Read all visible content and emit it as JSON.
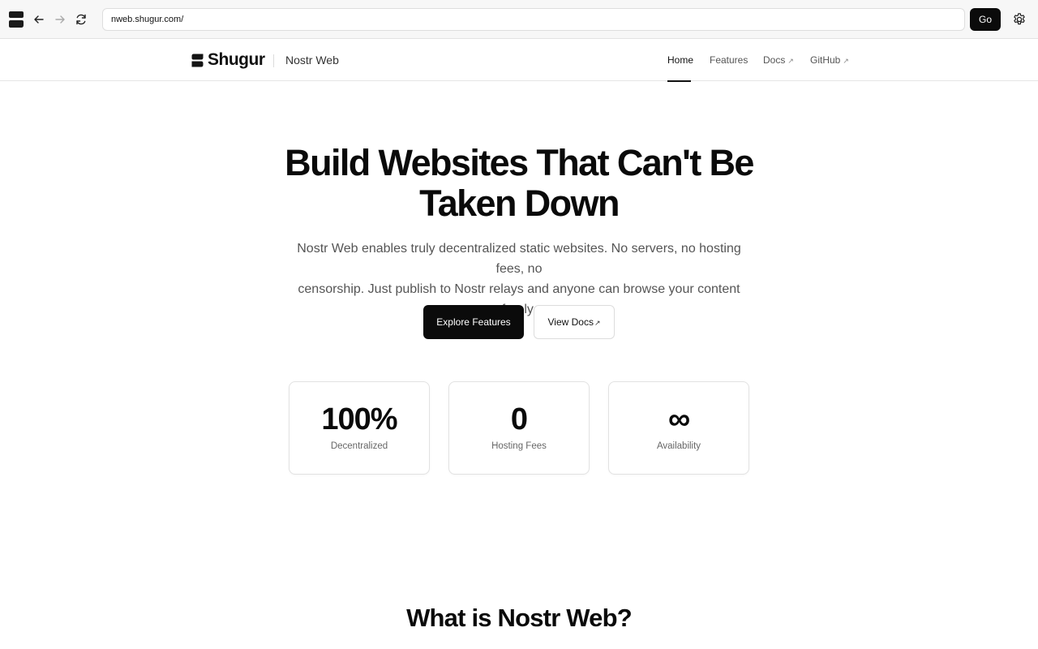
{
  "browser": {
    "url": "nweb.shugur.com/",
    "go_label": "Go",
    "icons": [
      "app-logo-icon",
      "back-arrow-icon",
      "forward-arrow-icon",
      "reload-icon",
      "gear-icon"
    ]
  },
  "header": {
    "brand_name": "Shugur",
    "product_name": "Nostr Web",
    "nav": [
      {
        "label": "Home",
        "active": true
      },
      {
        "label": "Features",
        "active": false
      },
      {
        "label": "Docs",
        "external": true
      },
      {
        "label": "GitHub",
        "external": true
      }
    ],
    "external_glyph": "↗"
  },
  "hero": {
    "title_line1": "Build Websites That Can't Be",
    "title_line2": "Taken Down",
    "subtitle_line1": "Nostr Web enables truly decentralized static websites. No servers, no hosting fees, no",
    "subtitle_line2": "censorship. Just publish to Nostr relays and anyone can browse your content freely.",
    "primary_cta": "Explore Features",
    "secondary_cta": "View Docs"
  },
  "stats": [
    {
      "value": "100%",
      "label": "Decentralized"
    },
    {
      "value": "0",
      "label": "Hosting Fees"
    },
    {
      "value": "∞",
      "label": "Availability"
    }
  ],
  "section": {
    "title": "What is Nostr Web?"
  },
  "colors": {
    "primary": "#0b0b0b",
    "muted_text": "#555555",
    "border": "#e2e2e2"
  }
}
